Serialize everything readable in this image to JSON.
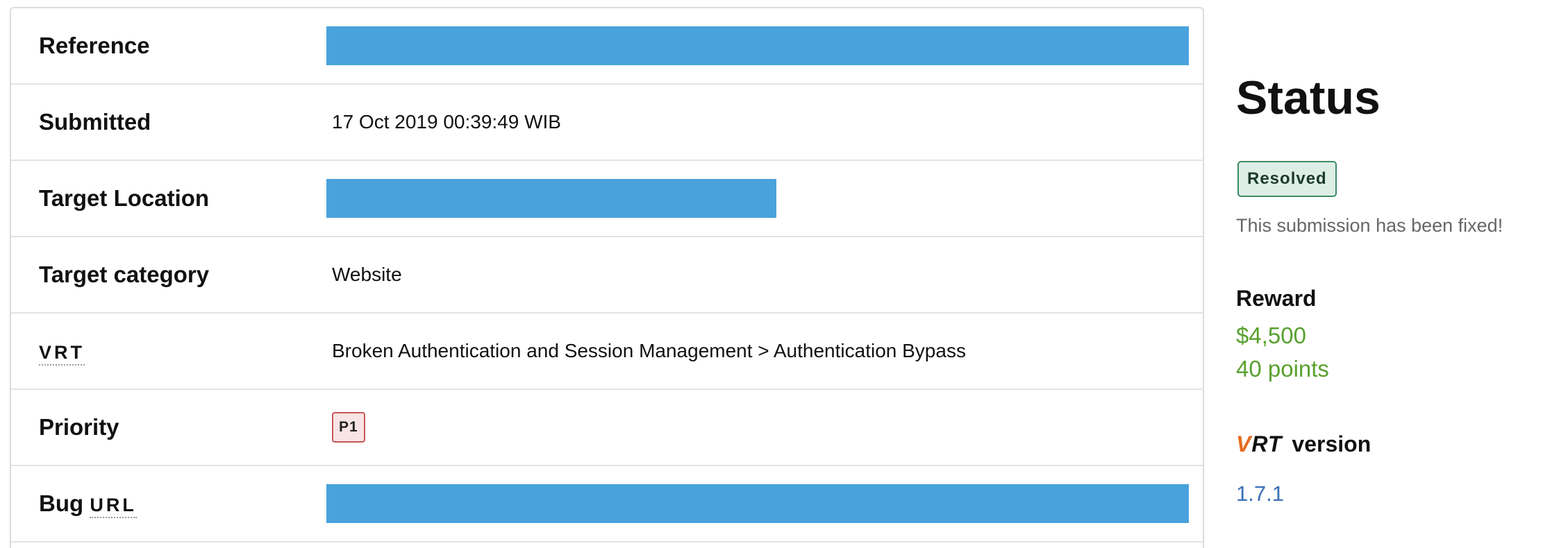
{
  "details": {
    "reference_label": "Reference",
    "submitted_label": "Submitted",
    "submitted_value": "17 Oct 2019 00:39:49 WIB",
    "target_location_label": "Target Location",
    "target_category_label": "Target category",
    "target_category_value": "Website",
    "vrt_label": "VRT",
    "vrt_value": "Broken Authentication and Session Management > Authentication Bypass",
    "priority_label": "Priority",
    "priority_value": "P1",
    "bug_url_label_prefix": "Bug",
    "bug_url_label_abbr": "URL",
    "redaction_color": "#49a2dc"
  },
  "sidebar": {
    "status_title": "Status",
    "status_badge": "Resolved",
    "status_text": "This submission has been fixed!",
    "reward_title": "Reward",
    "reward_amount": "$4,500",
    "reward_points": "40 points",
    "vrt_logo_text": "VRT",
    "vrt_version_title": "version",
    "vrt_version_value": "1.7.1",
    "reward_color": "#58a12f",
    "link_color": "#3a6fb5"
  }
}
